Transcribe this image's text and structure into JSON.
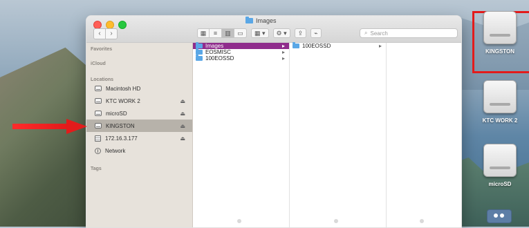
{
  "window": {
    "title": "Images",
    "search_placeholder": "Search"
  },
  "sidebar": {
    "sections": [
      {
        "label": "Favorites"
      },
      {
        "label": "iCloud"
      },
      {
        "label": "Locations"
      },
      {
        "label": "Tags"
      }
    ],
    "locations": [
      {
        "label": "Macintosh HD",
        "icon": "disk-icon",
        "eject": false
      },
      {
        "label": "KTC WORK 2",
        "icon": "disk-icon",
        "eject": true
      },
      {
        "label": "microSD",
        "icon": "disk-icon",
        "eject": true
      },
      {
        "label": "KINGSTON",
        "icon": "disk-icon",
        "eject": true,
        "selected": true
      },
      {
        "label": "172.16.3.177",
        "icon": "server-icon",
        "eject": true
      },
      {
        "label": "Network",
        "icon": "network-icon",
        "eject": false
      }
    ]
  },
  "columns": {
    "col1": [
      {
        "label": "Images",
        "selected": true
      },
      {
        "label": "EOSMISC",
        "selected": false
      },
      {
        "label": "100EOSSD",
        "selected": false
      }
    ],
    "col2": [
      {
        "label": "100EOSSD",
        "selected": false
      }
    ]
  },
  "desktop": {
    "drives": [
      {
        "label": "KINGSTON",
        "highlighted": true
      },
      {
        "label": "KTC WORK 2",
        "highlighted": false
      },
      {
        "label": "microSD",
        "highlighted": false
      }
    ]
  },
  "colors": {
    "accent_selection": "#8f2c8c",
    "sidebar_bg": "#e7e2db",
    "red_annotation": "#e31b1b",
    "folder_blue": "#5aa7e6"
  }
}
